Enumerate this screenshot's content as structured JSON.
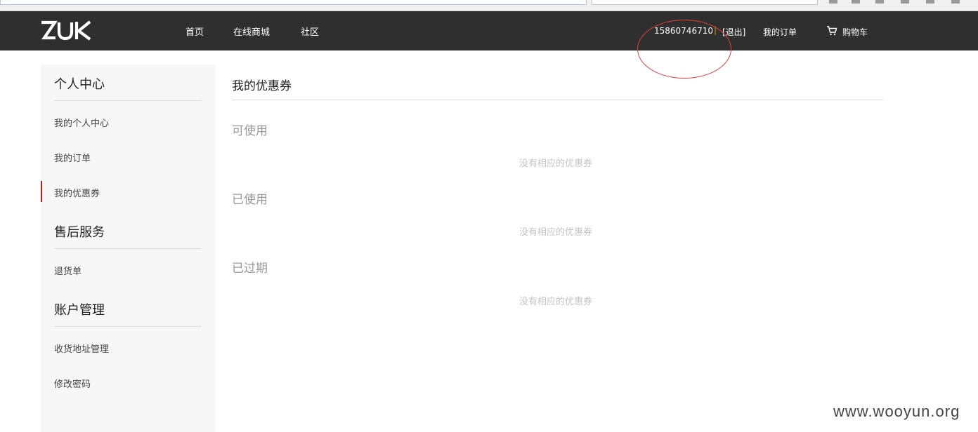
{
  "header": {
    "logo_text": "ZUK",
    "nav": [
      "首页",
      "在线商城",
      "社区"
    ],
    "user_id": "15860746710",
    "separator": "|",
    "logout": "[退出]",
    "orders": "我的订单",
    "cart": "购物车"
  },
  "sidebar": {
    "personal_heading": "个人中心",
    "personal_items": [
      "我的个人中心",
      "我的订单",
      "我的优惠券"
    ],
    "aftersale_heading": "售后服务",
    "aftersale_items": [
      "退货单"
    ],
    "account_heading": "账户管理",
    "account_items": [
      "收货地址管理",
      "修改密码"
    ]
  },
  "main": {
    "title": "我的优惠券",
    "sections": [
      {
        "title": "可使用",
        "empty": "没有相应的优惠券"
      },
      {
        "title": "已使用",
        "empty": "没有相应的优惠券"
      },
      {
        "title": "已过期",
        "empty": "没有相应的优惠券"
      }
    ]
  },
  "watermark": "www.wooyun.org",
  "colors": {
    "topbar": "#2f2f2f",
    "active_indicator": "#c8161d",
    "annotation": "#e0403c"
  }
}
